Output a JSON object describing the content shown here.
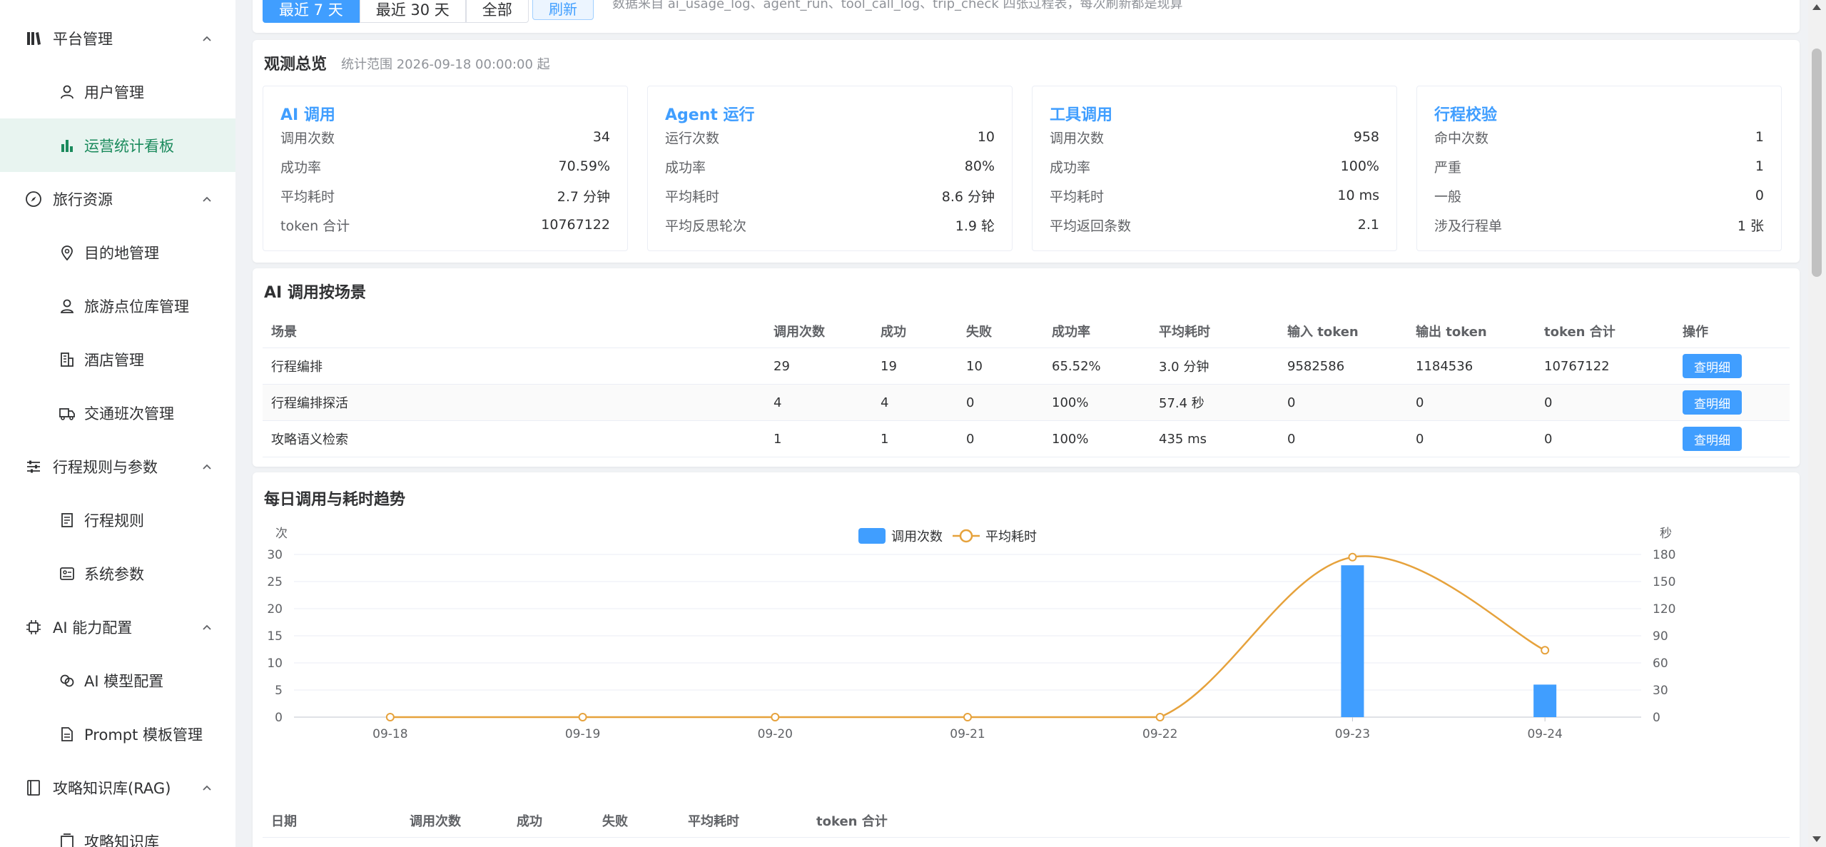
{
  "sidebar": {
    "groups": [
      {
        "label": "平台管理",
        "icon": "platform-icon",
        "items": [
          {
            "label": "用户管理",
            "icon": "user-icon"
          },
          {
            "label": "运营统计看板",
            "icon": "bar-chart-icon"
          }
        ]
      },
      {
        "label": "旅行资源",
        "icon": "compass-icon",
        "items": [
          {
            "label": "目的地管理",
            "icon": "location-pin-icon"
          },
          {
            "label": "旅游点位库管理",
            "icon": "map-pin-person-icon"
          },
          {
            "label": "酒店管理",
            "icon": "building-icon"
          },
          {
            "label": "交通班次管理",
            "icon": "truck-icon"
          }
        ]
      },
      {
        "label": "行程规则与参数",
        "icon": "sliders-icon",
        "items": [
          {
            "label": "行程规则",
            "icon": "document-icon"
          },
          {
            "label": "系统参数",
            "icon": "settings-panel-icon"
          }
        ]
      },
      {
        "label": "AI 能力配置",
        "icon": "chip-icon",
        "items": [
          {
            "label": "AI 模型配置",
            "icon": "link-circles-icon"
          },
          {
            "label": "Prompt 模板管理",
            "icon": "file-icon"
          }
        ]
      },
      {
        "label": "攻略知识库(RAG)",
        "icon": "book-icon",
        "items": [
          {
            "label": "攻略知识库",
            "icon": "book-stack-icon"
          }
        ]
      }
    ]
  },
  "toolbar": {
    "ranges": [
      "最近 7 天",
      "最近 30 天",
      "全部"
    ],
    "active_range": "最近 7 天",
    "refresh_label": "刷新",
    "source_note": "数据来自 ai_usage_log、agent_run、tool_call_log、trip_check 四张过程表，每次刷新都是现算"
  },
  "overview": {
    "title": "观测总览",
    "range_text": "统计范围 2026-09-18 00:00:00 起",
    "cards": [
      {
        "title": "AI 调用",
        "rows": [
          {
            "k": "调用次数",
            "v": "34"
          },
          {
            "k": "成功率",
            "v": "70.59%"
          },
          {
            "k": "平均耗时",
            "v": "2.7 分钟"
          },
          {
            "k": "token 合计",
            "v": "10767122"
          }
        ]
      },
      {
        "title": "Agent 运行",
        "rows": [
          {
            "k": "运行次数",
            "v": "10"
          },
          {
            "k": "成功率",
            "v": "80%"
          },
          {
            "k": "平均耗时",
            "v": "8.6 分钟"
          },
          {
            "k": "平均反思轮次",
            "v": "1.9 轮"
          }
        ]
      },
      {
        "title": "工具调用",
        "rows": [
          {
            "k": "调用次数",
            "v": "958"
          },
          {
            "k": "成功率",
            "v": "100%"
          },
          {
            "k": "平均耗时",
            "v": "10 ms"
          },
          {
            "k": "平均返回条数",
            "v": "2.1"
          }
        ]
      },
      {
        "title": "行程校验",
        "rows": [
          {
            "k": "命中次数",
            "v": "1"
          },
          {
            "k": "严重",
            "v": "1"
          },
          {
            "k": "一般",
            "v": "0"
          },
          {
            "k": "涉及行程单",
            "v": "1 张"
          }
        ]
      }
    ]
  },
  "scene_table": {
    "title": "AI 调用按场景",
    "headers": [
      "场景",
      "调用次数",
      "成功",
      "失败",
      "成功率",
      "平均耗时",
      "输入 token",
      "输出 token",
      "token 合计",
      "操作"
    ],
    "rows": [
      [
        "行程编排",
        "29",
        "19",
        "10",
        "65.52%",
        "3.0 分钟",
        "9582586",
        "1184536",
        "10767122"
      ],
      [
        "行程编排探活",
        "4",
        "4",
        "0",
        "100%",
        "57.4 秒",
        "0",
        "0",
        "0"
      ],
      [
        "攻略语义检索",
        "1",
        "1",
        "0",
        "100%",
        "435 ms",
        "0",
        "0",
        "0"
      ]
    ],
    "action_label": "查明细"
  },
  "trend": {
    "title": "每日调用与耗时趋势",
    "bottom_headers": [
      "日期",
      "调用次数",
      "成功",
      "失败",
      "平均耗时",
      "token 合计"
    ]
  },
  "chart_data": {
    "type": "bar",
    "categories": [
      "09-18",
      "09-19",
      "09-20",
      "09-21",
      "09-22",
      "09-23",
      "09-24"
    ],
    "series": [
      {
        "name": "调用次数",
        "type": "bar",
        "axis": "left",
        "values": [
          0,
          0,
          0,
          0,
          0,
          28,
          6
        ],
        "color": "#409eff"
      },
      {
        "name": "平均耗时",
        "type": "line",
        "axis": "right",
        "values": [
          0,
          0,
          0,
          0,
          0,
          177,
          74
        ],
        "color": "#e6a23c"
      }
    ],
    "ylabel_left": "次",
    "ylabel_right": "秒",
    "ylim_left": [
      0,
      30
    ],
    "ylim_right": [
      0,
      180
    ],
    "yticks_left": [
      "0",
      "5",
      "10",
      "15",
      "20",
      "25",
      "30"
    ],
    "yticks_right": [
      "0",
      "30",
      "60",
      "90",
      "120",
      "150",
      "180"
    ],
    "legend": "top-center",
    "grid": true
  }
}
